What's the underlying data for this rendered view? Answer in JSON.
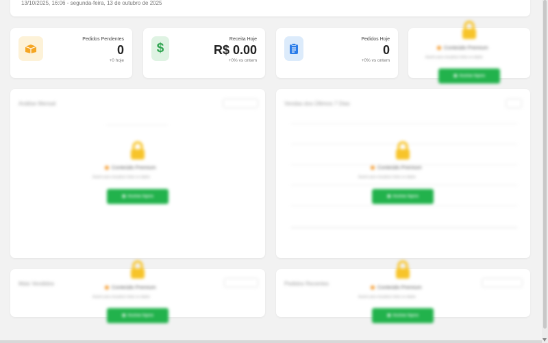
{
  "header": {
    "datetime": "13/10/2025, 16:06 - segunda-feira, 13 de outubro de 2025"
  },
  "stats": [
    {
      "label": "Pedidos Pendentes",
      "value": "0",
      "sub": "+0 hoje",
      "icon": "box-icon",
      "color": "#f5a623",
      "bg": "#fdf2d8"
    },
    {
      "label": "Receita Hoje",
      "value": "R$ 0.00",
      "sub": "+0% vs ontem",
      "icon": "dollar-icon",
      "color": "#2ea44f",
      "bg": "#dff3e3"
    },
    {
      "label": "Pedidos Hoje",
      "value": "0",
      "sub": "+0% vs ontem",
      "icon": "clipboard-icon",
      "color": "#2b7de9",
      "bg": "#dcebfb"
    }
  ],
  "premium": {
    "title": "Conteúdo Premium",
    "subtitle": "Assine para visualizar todos os dados",
    "button": "Assinar Agora"
  },
  "blurred": {
    "panel1_title": "Análise Mensal",
    "panel2_title": "Vendas dos Últimos 7 Dias",
    "panel3_title": "Mais Vendidos",
    "panel4_title": "Pedidos Recentes"
  },
  "colors": {
    "accent_green": "#22b24c",
    "lock_yellow": "#f7c42a",
    "premium_dot": "#f29a2e"
  }
}
